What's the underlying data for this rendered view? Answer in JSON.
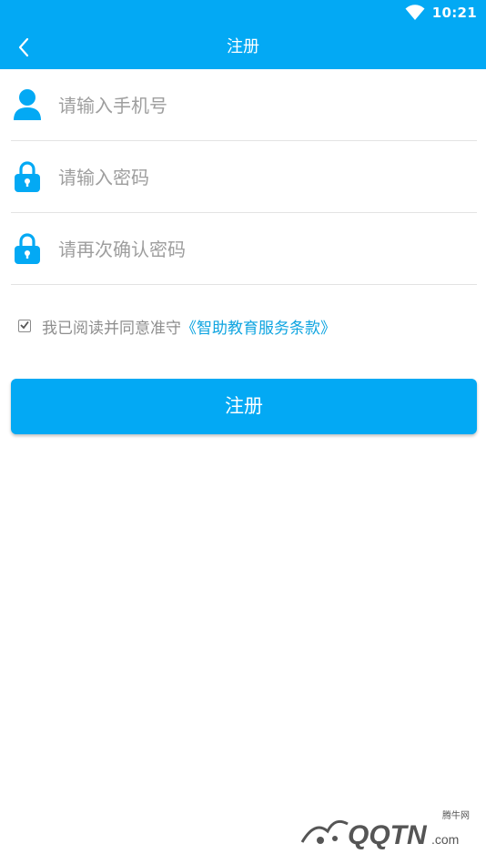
{
  "status_bar": {
    "time": "10:21"
  },
  "toolbar": {
    "title": "注册"
  },
  "form": {
    "phone_placeholder": "请输入手机号",
    "password_placeholder": "请输入密码",
    "confirm_placeholder": "请再次确认密码"
  },
  "agreement": {
    "checked": true,
    "text": "我已阅读并同意准守",
    "link_text": "《智助教育服务条款》"
  },
  "register_button": {
    "label": "注册"
  },
  "colors": {
    "primary": "#03a9f4",
    "link": "#0ea4e0"
  },
  "watermark": {
    "label": "腾牛网"
  }
}
